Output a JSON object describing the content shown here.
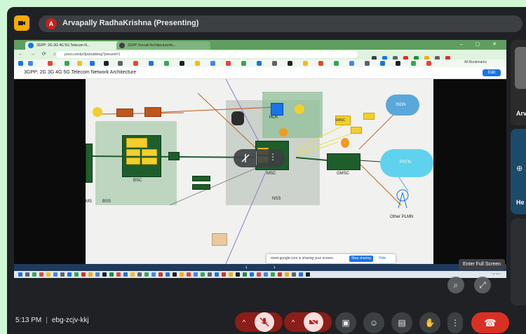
{
  "presenter": {
    "initial": "A",
    "name": "Arvapally RadhaKrishna (Presenting)"
  },
  "browser": {
    "tabs": [
      "3GPP: 2G 3G 4G 5G Telecom N...",
      "3GPP Overall Architecture/Ar..."
    ],
    "window_controls": "– ▢ ✕",
    "url": "prezi.com/p/3pcbudoksg?present=1",
    "doc_title": "3GPP; 2G 3G 4G 5G Telecom Network Architecture",
    "edit_label": "Edit",
    "bookmark_left": "All Bookmarks"
  },
  "diagram": {
    "labels": {
      "isdn": "ISDN",
      "pstn": "PSTN",
      "other_plmn": "Other PLMN",
      "msc": "MSC",
      "gmsc": "GMSC",
      "nss": "NSS",
      "bsc": "BSC",
      "bss": "BSS",
      "ms": "MS",
      "smsc": "SMSC",
      "hlr": "HLR"
    }
  },
  "share_bar": {
    "text": "meet.google.com is sharing your screen.",
    "stop_label": "Stop sharing",
    "hide_label": "Hide"
  },
  "fullscreen_tooltip": "Enter Full Screen",
  "side_tiles": {
    "tile1_name": "Arv",
    "tile2_name": "He"
  },
  "meeting": {
    "time": "5:13 PM",
    "separator": "|",
    "code": "ebg-zcjv-kkj"
  },
  "colors": {
    "background": "#cff7d6",
    "meet_bg": "#202124",
    "end_call": "#d93025",
    "muted_bg": "#f9dedc",
    "accent_blue": "#1a73e8"
  }
}
